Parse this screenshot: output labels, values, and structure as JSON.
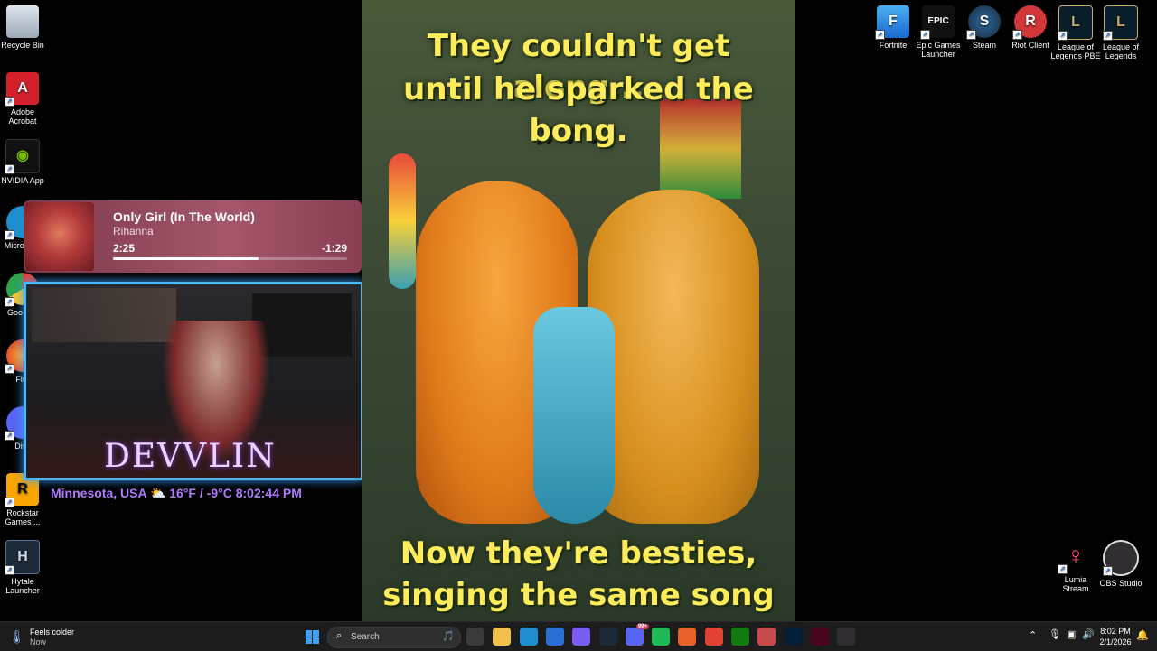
{
  "desktop_left": [
    {
      "label": "Recycle Bin",
      "icon": "recycle-bin-icon",
      "color": "#c8d2dc"
    },
    {
      "label": "Adobe Acrobat",
      "icon": "acrobat-icon",
      "color": "#d4202a"
    },
    {
      "label": "NVIDIA App",
      "icon": "nvidia-icon",
      "color": "#1a1a1a"
    },
    {
      "label": "Micro Edg",
      "icon": "edge-icon",
      "color": "#1e8ed0"
    },
    {
      "label": "Goo Chr",
      "icon": "chrome-icon",
      "color": "#e34133"
    },
    {
      "label": "Fire",
      "icon": "firefox-icon",
      "color": "#e8602a"
    },
    {
      "label": "Disc",
      "icon": "discord-icon",
      "color": "#5865f2"
    },
    {
      "label": "Rockstar Games ...",
      "icon": "rockstar-icon",
      "color": "#f8a500"
    },
    {
      "label": "Hytale Launcher",
      "icon": "hytale-icon",
      "color": "#1c2a3a"
    }
  ],
  "desktop_right": [
    {
      "label": "Fortnite",
      "icon": "fortnite-icon",
      "color": "#2a8ae0",
      "glyph": "F"
    },
    {
      "label": "Epic Games Launcher",
      "icon": "epic-games-icon",
      "color": "#111111",
      "glyph": "EPIC"
    },
    {
      "label": "Steam",
      "icon": "steam-icon",
      "color": "#1b2838",
      "glyph": "S"
    },
    {
      "label": "Riot Client",
      "icon": "riot-icon",
      "color": "#d13639",
      "glyph": "R"
    },
    {
      "label": "League of Legends PBE",
      "icon": "league-pbe-icon",
      "color": "#0a1e2a",
      "glyph": "L"
    },
    {
      "label": "League of Legends",
      "icon": "league-icon",
      "color": "#0a1e2a",
      "glyph": "L"
    }
  ],
  "desktop_bottom_right": [
    {
      "label": "Lumia Stream",
      "icon": "lumia-icon",
      "color": "#ff4a6a"
    },
    {
      "label": "OBS Studio",
      "icon": "obs-icon",
      "color": "#302e31"
    }
  ],
  "now_playing": {
    "title": "Only Girl (In The World)",
    "artist": "Rihanna",
    "elapsed": "2:25",
    "remaining": "-1:29",
    "progress": 0.62
  },
  "webcam": {
    "overlay_name": "DEVVLIN",
    "location": "Minnesota, USA",
    "weather_icon": "partly-cloudy-icon",
    "temperature": "16°F / -9°C",
    "time": "8:02:44 PM"
  },
  "poster": {
    "line1": "They couldn't get along...",
    "line2": "until he sparked the bong.",
    "line3": "Now they're besties,",
    "line4": "singing the same song"
  },
  "taskbar": {
    "weather_line1": "Feels colder",
    "weather_line2": "Now",
    "search_placeholder": "Search",
    "clock_time": "8:02 PM",
    "clock_date": "2/1/2026",
    "apps": [
      {
        "icon": "task-view-icon",
        "color": "#3a3a3a"
      },
      {
        "icon": "file-explorer-icon",
        "color": "#f2c14b"
      },
      {
        "icon": "edge-icon",
        "color": "#1e8ed0"
      },
      {
        "icon": "store-icon",
        "color": "#2a6fd6"
      },
      {
        "icon": "copilot-icon",
        "color": "#7a5cf0"
      },
      {
        "icon": "steam-icon",
        "color": "#1b2838"
      },
      {
        "icon": "discord-icon",
        "color": "#5865f2",
        "badge": "99+"
      },
      {
        "icon": "spotify-icon",
        "color": "#1db954"
      },
      {
        "icon": "firefox-icon",
        "color": "#e8602a"
      },
      {
        "icon": "chrome-icon",
        "color": "#e34133"
      },
      {
        "icon": "xbox-icon",
        "color": "#107c10"
      },
      {
        "icon": "snipping-tool-icon",
        "color": "#c84a4a"
      },
      {
        "icon": "photoshop-icon",
        "color": "#001e36"
      },
      {
        "icon": "indesign-icon",
        "color": "#49021f"
      },
      {
        "icon": "obs-icon",
        "color": "#302e31"
      }
    ]
  }
}
